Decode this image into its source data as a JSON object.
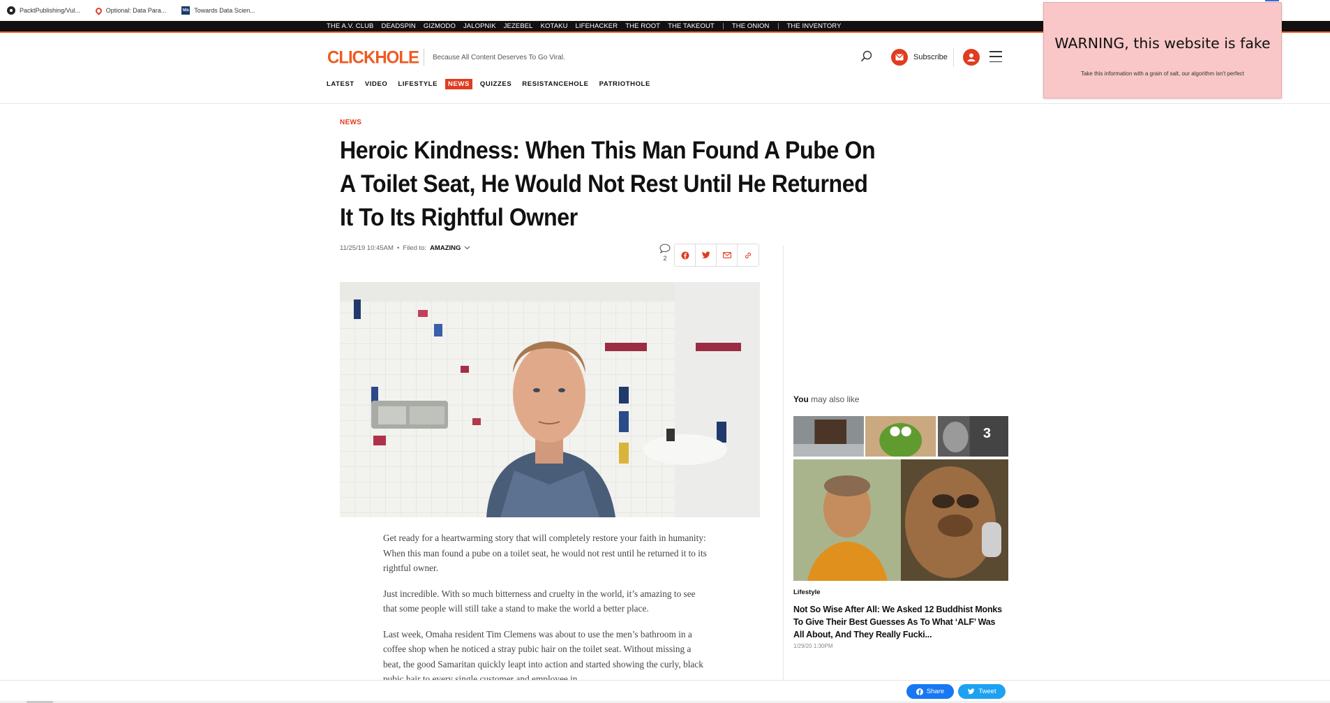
{
  "bookmarks": [
    {
      "label": "PacktPublishing/Vul...",
      "icon": "github-icon"
    },
    {
      "label": "Optional: Data Para...",
      "icon": "opera-icon"
    },
    {
      "label": "Towards Data Scien...",
      "icon": "tds-icon"
    }
  ],
  "network": {
    "links_a": [
      "THE A.V. CLUB",
      "DEADSPIN",
      "GIZMODO",
      "JALOPNIK",
      "JEZEBEL",
      "KOTAKU",
      "LIFEHACKER",
      "THE ROOT",
      "THE TAKEOUT"
    ],
    "links_b": [
      "THE ONION"
    ],
    "links_c": [
      "THE INVENTORY"
    ]
  },
  "header": {
    "logo": "CLICKHOLE",
    "tagline": "Because All Content Deserves To Go Viral.",
    "subscribe_label": "Subscribe"
  },
  "nav": {
    "items": [
      "LATEST",
      "VIDEO",
      "LIFESTYLE",
      "NEWS",
      "QUIZZES",
      "RESISTANCEHOLE",
      "PATRIOTHOLE"
    ],
    "active": "NEWS"
  },
  "article": {
    "kicker": "NEWS",
    "headline": "Heroic Kindness: When This Man Found A Pube On A Toilet Seat, He Would Not Rest Until He Returned It To Its Rightful Owner",
    "date": "11/25/19 10:45AM",
    "filed_prefix": "Filed to:",
    "filed_category": "AMAZING",
    "comment_count": "2",
    "paragraphs": [
      "Get ready for a heartwarming story that will completely restore your faith in humanity: When this man found a pube on a toilet seat, he would not rest until he returned it to its rightful owner.",
      "Just incredible. With so much bitterness and cruelty in the world, it’s amazing to see that some people will still take a stand to make the world a better place.",
      "Last week, Omaha resident Tim Clemens was about to use the men’s bathroom in a coffee shop when he noticed a stray pubic hair on the toilet seat. Without missing a beat, the good Samaritan quickly leapt into action and started showing the curly, black pubic hair to every single customer and employee in"
    ]
  },
  "sidebar": {
    "title_bold": "You",
    "title_rest": " may also like",
    "thumb_count": "3",
    "category": "Lifestyle",
    "headline": "Not So Wise After All: We Asked 12 Buddhist Monks To Give Their Best Guesses As To What ‘ALF’ Was All About, And They Really Fucki...",
    "date": "1/29/20 1:30PM"
  },
  "bottom_bar": {
    "share_label": "Share",
    "tweet_label": "Tweet"
  },
  "warning": {
    "title": "WARNING, this website is fake",
    "subtitle": "Take this information with a grain of salt, our algorithm isn't perfect"
  },
  "colors": {
    "brand_orange": "#f05a22",
    "brand_red": "#e13c1f",
    "warning_bg": "#f9c7c7",
    "facebook": "#1877f2",
    "twitter": "#1da1f2"
  }
}
